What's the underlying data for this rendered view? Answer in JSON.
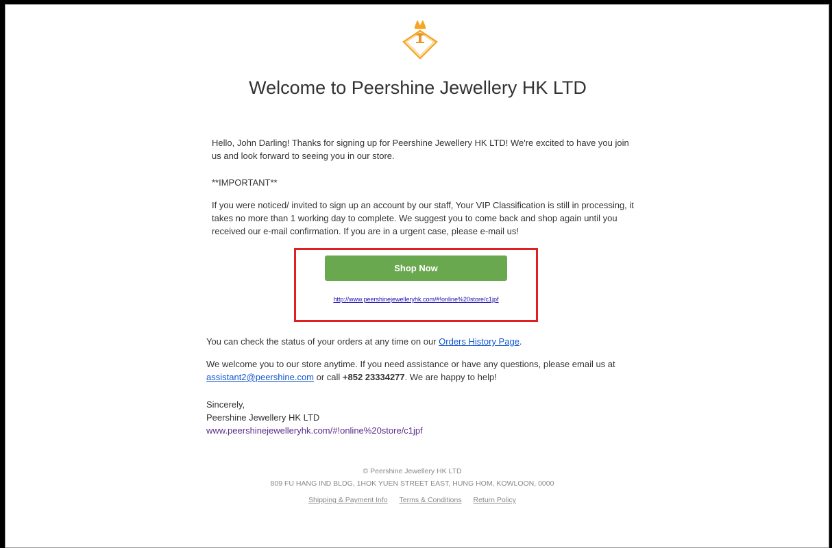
{
  "header": {
    "title": "Welcome to Peershine Jewellery HK LTD"
  },
  "greeting": {
    "text": "Hello, John Darling! Thanks for signing up for Peershine Jewellery HK LTD! We're excited to have you join us and look forward to seeing you in our store."
  },
  "important": {
    "label": "**IMPORTANT**",
    "text": "If you were noticed/ invited to sign up an account by our staff, Your VIP Classification is still in processing, it takes no more than 1 working day to complete. We suggest you to come back and shop again until you received our e-mail confirmation. If you are in a urgent case, please e-mail us!"
  },
  "cta": {
    "button_label": "Shop Now",
    "link_text": "http://www.peershinejewelleryhk.com/#!online%20store/c1jpf"
  },
  "orders": {
    "prefix": "You can check the status of your orders at any time on our ",
    "link_text": "Orders History Page",
    "suffix": "."
  },
  "assistance": {
    "text1": "We welcome you to our store anytime. If you need assistance or have any questions, please email us at ",
    "email": "assistant2@peershine.com",
    "text2": " or call ",
    "phone": "+852 23334277",
    "text3": ". We are happy to help!"
  },
  "signoff": {
    "line1": "Sincerely,",
    "line2": "Peershine Jewellery HK LTD",
    "line3": "www.peershinejewelleryhk.com/#!online%20store/c1jpf"
  },
  "footer": {
    "copyright": "© Peershine Jewellery HK LTD",
    "address": "809 FU HANG IND BLDG, 1HOK YUEN STREET EAST, HUNG HOM, KOWLOON, 0000",
    "links": [
      "Shipping & Payment Info",
      "Terms & Conditions",
      "Return Policy"
    ]
  },
  "colors": {
    "button": "#6aa84f",
    "highlight": "#e02020",
    "logo": "#f5a623"
  }
}
